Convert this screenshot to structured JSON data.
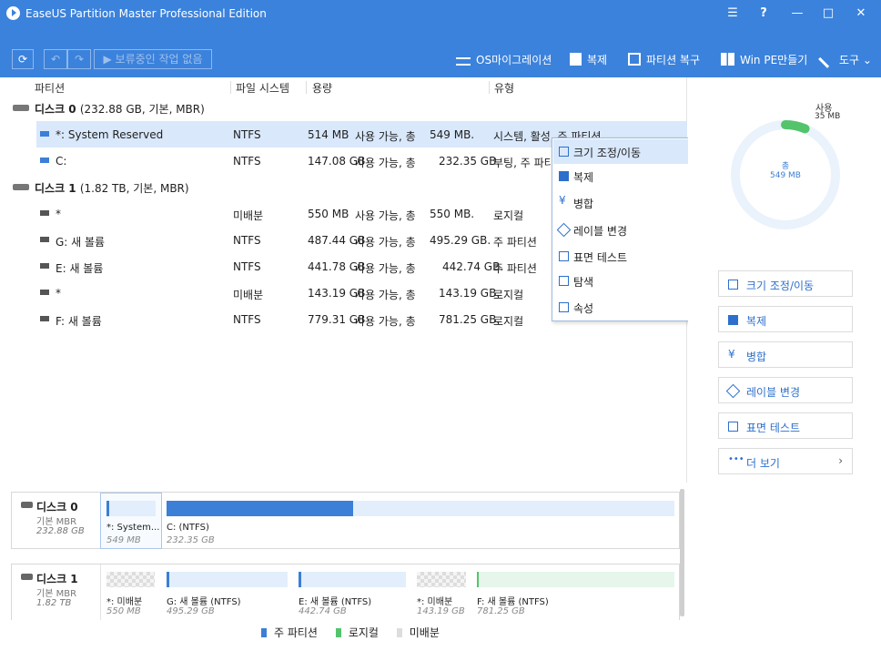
{
  "app": {
    "title": "EaseUS Partition Master Professional Edition",
    "window_buttons": [
      "☰",
      "?",
      "—",
      "□",
      "✕"
    ]
  },
  "toolbar": {
    "refresh": "⟳",
    "undo": "↶",
    "redo": "↷",
    "pending": "▶ 보류중인 작업 없음",
    "os_migrate": "OS마이그레이션",
    "clone": "복제",
    "partition_recovery": "파티션 복구",
    "winpe": "Win PE만들기",
    "tools": "도구"
  },
  "columns": [
    "파티션",
    "파일 시스템",
    "용량",
    "유형"
  ],
  "disks": [
    {
      "name": "디스크 0",
      "meta": "(232.88 GB, 기본, MBR)",
      "partitions": [
        {
          "name": "*: System Reserved",
          "fs": "NTFS",
          "used": "514 MB",
          "avail": "사용 가능, 총",
          "total": "549 MB.",
          "type": "시스템, 활성, 주 파티션"
        },
        {
          "name": "C:",
          "fs": "NTFS",
          "used": "147.08 GB",
          "avail": "사용 가능, 총",
          "total": "232.35 GB.",
          "type": "부팅, 주 파티션"
        }
      ]
    },
    {
      "name": "디스크 1",
      "meta": "(1.82 TB, 기본, MBR)",
      "partitions": [
        {
          "name": "*",
          "fs": "미배분",
          "used": "550 MB",
          "avail": "사용 가능, 총",
          "total": "550 MB.",
          "type": "로지컬"
        },
        {
          "name": "G: 새 볼륨",
          "fs": "NTFS",
          "used": "487.44 GB",
          "avail": "사용 가능, 총",
          "total": "495.29 GB.",
          "type": "주 파티션"
        },
        {
          "name": "E: 새 볼륨",
          "fs": "NTFS",
          "used": "441.78 GB",
          "avail": "사용 가능, 총",
          "total": "442.74 GB.",
          "type": "주 파티션"
        },
        {
          "name": "*",
          "fs": "미배분",
          "used": "143.19 GB",
          "avail": "사용 가능, 총",
          "total": "143.19 GB.",
          "type": "로지컬"
        },
        {
          "name": "F: 새 볼륨",
          "fs": "NTFS",
          "used": "779.31 GB",
          "avail": "사용 가능, 총",
          "total": "781.25 GB.",
          "type": "로지컬"
        }
      ]
    }
  ],
  "context_menu": [
    "크기 조정/이동",
    "복제",
    "병합",
    "레이블 변경",
    "표면 테스트",
    "탐색",
    "속성"
  ],
  "usage": {
    "label": "사용",
    "value": "35 MB",
    "total_label": "총",
    "total_value": "549 MB",
    "used_fraction": 0.064
  },
  "actions": [
    "크기 조정/이동",
    "복제",
    "병합",
    "레이블 변경",
    "표면 테스트",
    "더 보기"
  ],
  "map": {
    "disk0": {
      "name": "디스크 0",
      "type": "기본 MBR",
      "size": "232.88 GB",
      "segs": [
        {
          "label": "*: System...",
          "size": "549 MB"
        },
        {
          "label": "C:  (NTFS)",
          "size": "232.35 GB"
        }
      ]
    },
    "disk1": {
      "name": "디스크 1",
      "type": "기본 MBR",
      "size": "1.82 TB",
      "segs": [
        {
          "label": "*: 미배분",
          "size": "550 MB"
        },
        {
          "label": "G: 새 볼륨 (NTFS)",
          "size": "495.29 GB"
        },
        {
          "label": "E: 새 볼륨 (NTFS)",
          "size": "442.74 GB"
        },
        {
          "label": "*: 미배분",
          "size": "143.19 GB"
        },
        {
          "label": "F: 새 볼륨 (NTFS)",
          "size": "781.25 GB"
        }
      ]
    }
  },
  "legend": [
    "주 파티션",
    "로지컬",
    "미배분"
  ],
  "colors": {
    "accent": "#3b82dc",
    "primary": "#3b7fd6",
    "logical": "#54c46c",
    "selected": "#d9e8fb"
  }
}
